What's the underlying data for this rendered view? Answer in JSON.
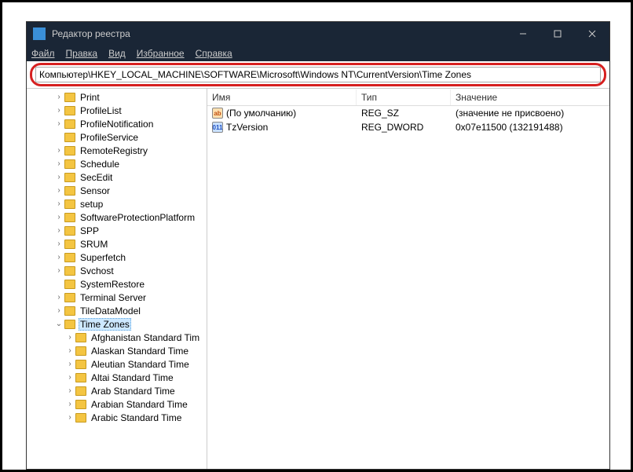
{
  "window": {
    "title": "Редактор реестра"
  },
  "menu": {
    "file": "Файл",
    "edit": "Правка",
    "view": "Вид",
    "favorites": "Избранное",
    "help": "Справка"
  },
  "address": {
    "value": "Компьютер\\HKEY_LOCAL_MACHINE\\SOFTWARE\\Microsoft\\Windows NT\\CurrentVersion\\Time Zones"
  },
  "columns": {
    "name": "Имя",
    "type": "Тип",
    "data": "Значение"
  },
  "tree": {
    "items": [
      {
        "label": "Print",
        "level": 1,
        "exp": ">"
      },
      {
        "label": "ProfileList",
        "level": 1,
        "exp": ">"
      },
      {
        "label": "ProfileNotification",
        "level": 1,
        "exp": ">"
      },
      {
        "label": "ProfileService",
        "level": 1,
        "exp": ""
      },
      {
        "label": "RemoteRegistry",
        "level": 1,
        "exp": ">"
      },
      {
        "label": "Schedule",
        "level": 1,
        "exp": ">"
      },
      {
        "label": "SecEdit",
        "level": 1,
        "exp": ">"
      },
      {
        "label": "Sensor",
        "level": 1,
        "exp": ">"
      },
      {
        "label": "setup",
        "level": 1,
        "exp": ">"
      },
      {
        "label": "SoftwareProtectionPlatform",
        "level": 1,
        "exp": ">"
      },
      {
        "label": "SPP",
        "level": 1,
        "exp": ">"
      },
      {
        "label": "SRUM",
        "level": 1,
        "exp": ">"
      },
      {
        "label": "Superfetch",
        "level": 1,
        "exp": ">"
      },
      {
        "label": "Svchost",
        "level": 1,
        "exp": ">"
      },
      {
        "label": "SystemRestore",
        "level": 1,
        "exp": ""
      },
      {
        "label": "Terminal Server",
        "level": 1,
        "exp": ">"
      },
      {
        "label": "TileDataModel",
        "level": 1,
        "exp": ">"
      },
      {
        "label": "Time Zones",
        "level": 1,
        "exp": "v",
        "selected": true
      },
      {
        "label": "Afghanistan Standard Tim",
        "level": 2,
        "exp": ">"
      },
      {
        "label": "Alaskan Standard Time",
        "level": 2,
        "exp": ">"
      },
      {
        "label": "Aleutian Standard Time",
        "level": 2,
        "exp": ">"
      },
      {
        "label": "Altai Standard Time",
        "level": 2,
        "exp": ">"
      },
      {
        "label": "Arab Standard Time",
        "level": 2,
        "exp": ">"
      },
      {
        "label": "Arabian Standard Time",
        "level": 2,
        "exp": ">"
      },
      {
        "label": "Arabic Standard Time",
        "level": 2,
        "exp": ">"
      }
    ]
  },
  "values": [
    {
      "icon": "sz",
      "iconText": "ab",
      "name": "(По умолчанию)",
      "type": "REG_SZ",
      "data": "(значение не присвоено)"
    },
    {
      "icon": "dw",
      "iconText": "011",
      "name": "TzVersion",
      "type": "REG_DWORD",
      "data": "0x07e11500 (132191488)"
    }
  ]
}
